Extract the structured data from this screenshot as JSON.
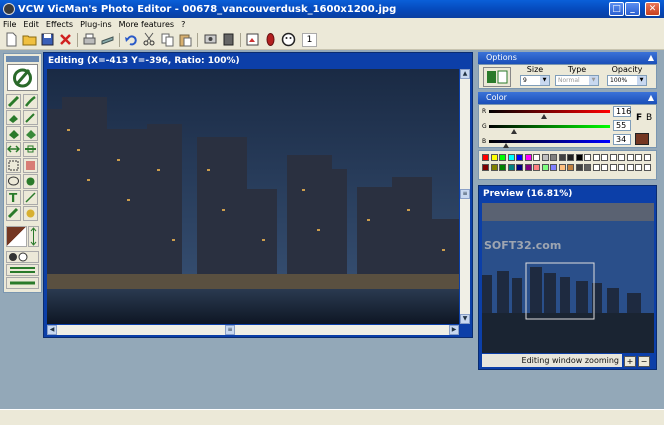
{
  "window": {
    "title": "VCW VicMan's Photo Editor - 00678_vancouverdusk_1600x1200.jpg"
  },
  "menu": [
    "File",
    "Edit",
    "Effects",
    "Plug-ins",
    "More features",
    "?"
  ],
  "toolbar": {
    "page_number": "1"
  },
  "editing": {
    "title": "Editing (X=-413 Y=-396, Ratio: 100%)"
  },
  "options": {
    "header": "Options",
    "size_label": "Size",
    "type_label": "Type",
    "opacity_label": "Opacity",
    "size_value": "9",
    "type_value": "Normal",
    "opacity_value": "100%"
  },
  "color": {
    "header": "Color",
    "r_label": "R",
    "g_label": "G",
    "b_label": "B",
    "r_value": "116",
    "g_value": "55",
    "b_value": "34",
    "f_label": "F",
    "b_side_label": "B",
    "accent": "#743722"
  },
  "preview": {
    "title": "Preview (16.81%)",
    "watermark": "SOFT32.com",
    "status": "Editing window zooming"
  }
}
